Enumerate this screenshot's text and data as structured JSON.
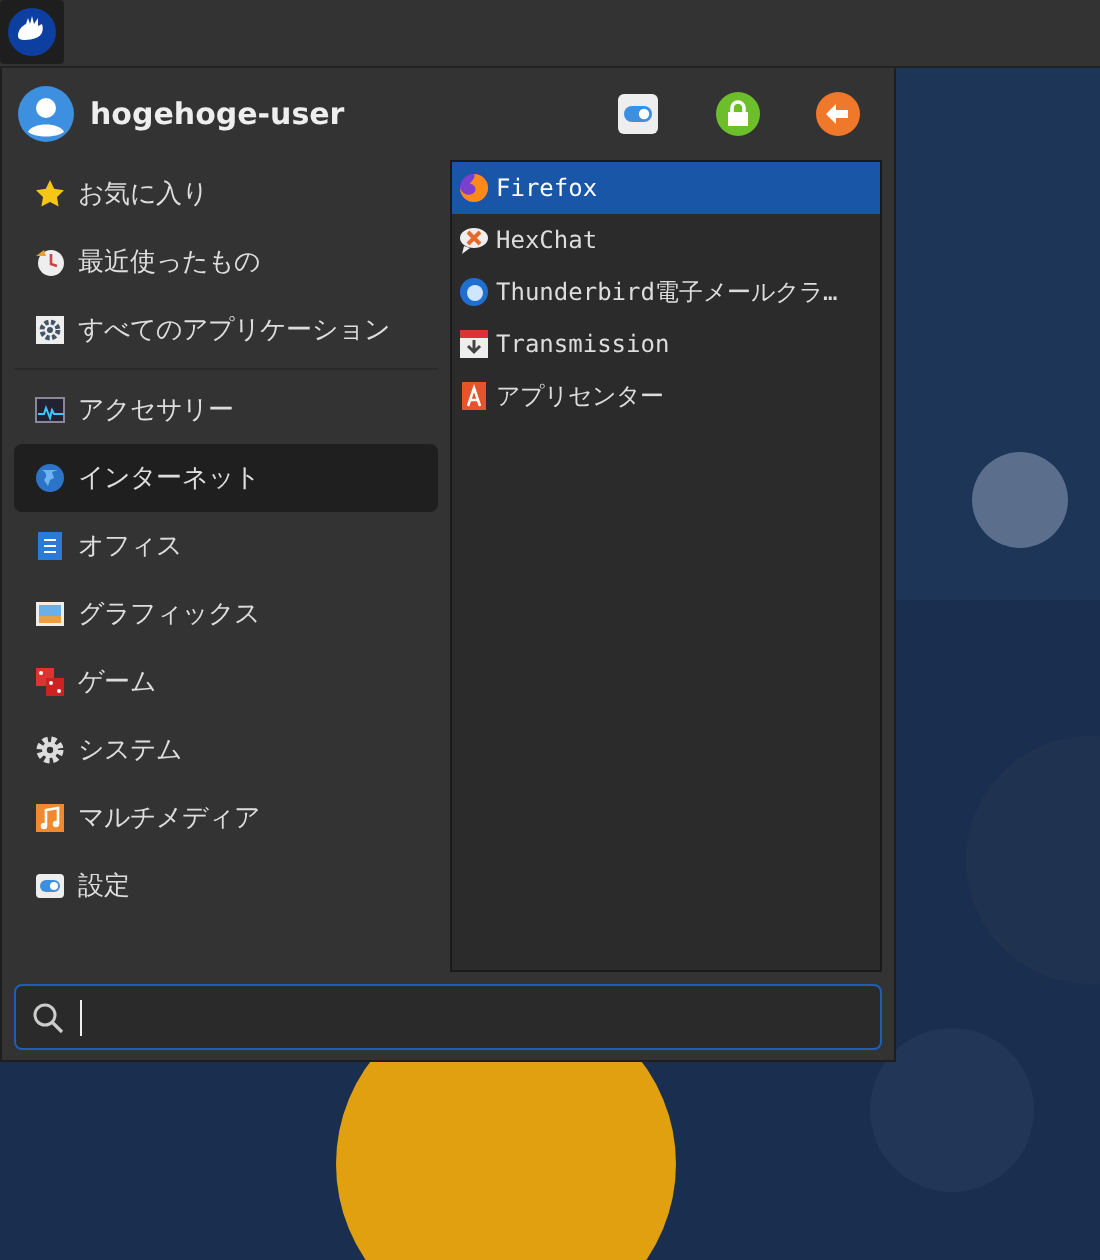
{
  "user": {
    "name": "hogehoge-user"
  },
  "places": [
    {
      "label": "お気に入り",
      "selected": false
    },
    {
      "label": "最近使ったもの",
      "selected": false
    },
    {
      "label": "すべてのアプリケーション",
      "selected": false
    }
  ],
  "categories": [
    {
      "label": "アクセサリー",
      "selected": false
    },
    {
      "label": "インターネット",
      "selected": true
    },
    {
      "label": "オフィス",
      "selected": false
    },
    {
      "label": "グラフィックス",
      "selected": false
    },
    {
      "label": "ゲーム",
      "selected": false
    },
    {
      "label": "システム",
      "selected": false
    },
    {
      "label": "マルチメディア",
      "selected": false
    },
    {
      "label": "設定",
      "selected": false
    }
  ],
  "apps": [
    {
      "label": "Firefox",
      "selected": true
    },
    {
      "label": "HexChat",
      "selected": false
    },
    {
      "label": "Thunderbird電子メールクラ…",
      "selected": false
    },
    {
      "label": "Transmission",
      "selected": false
    },
    {
      "label": "アプリセンター",
      "selected": false
    }
  ],
  "search": {
    "focused": true
  }
}
